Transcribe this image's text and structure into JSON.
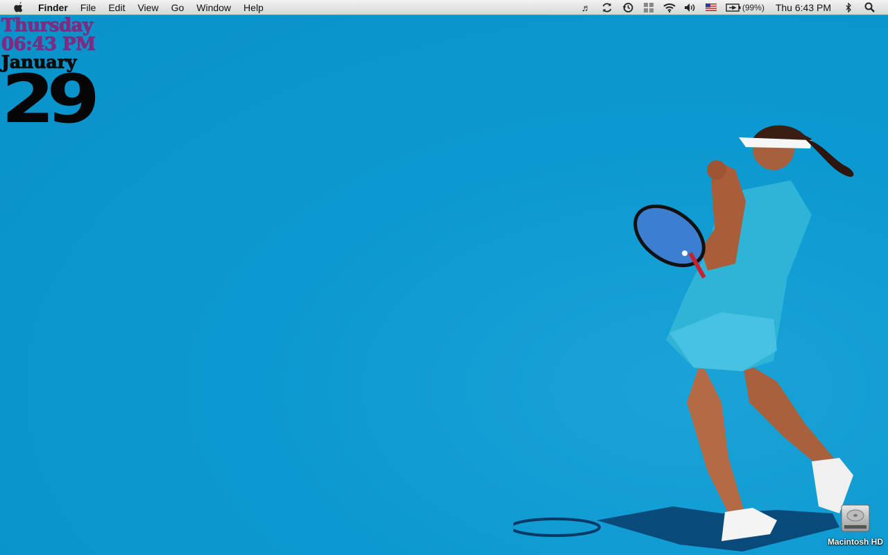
{
  "menubar": {
    "app_name": "Finder",
    "items": [
      "File",
      "Edit",
      "View",
      "Go",
      "Window",
      "Help"
    ],
    "status": {
      "battery_percent": "(99%)",
      "clock": "Thu 6:43 PM"
    },
    "icons": [
      "apple-icon",
      "music-note-icon",
      "sync-icon",
      "time-machine-icon",
      "spaces-icon",
      "wifi-icon",
      "volume-icon",
      "us-flag-icon",
      "battery-icon",
      "bluetooth-icon",
      "spotlight-search-icon"
    ]
  },
  "date_widget": {
    "day": "Thursday",
    "time": "06:43 PM",
    "month": "January",
    "date": "29"
  },
  "desktop": {
    "drive_label": "Macintosh HD",
    "background_color": "#0a96cf",
    "text_purple": "#7a2d83"
  }
}
